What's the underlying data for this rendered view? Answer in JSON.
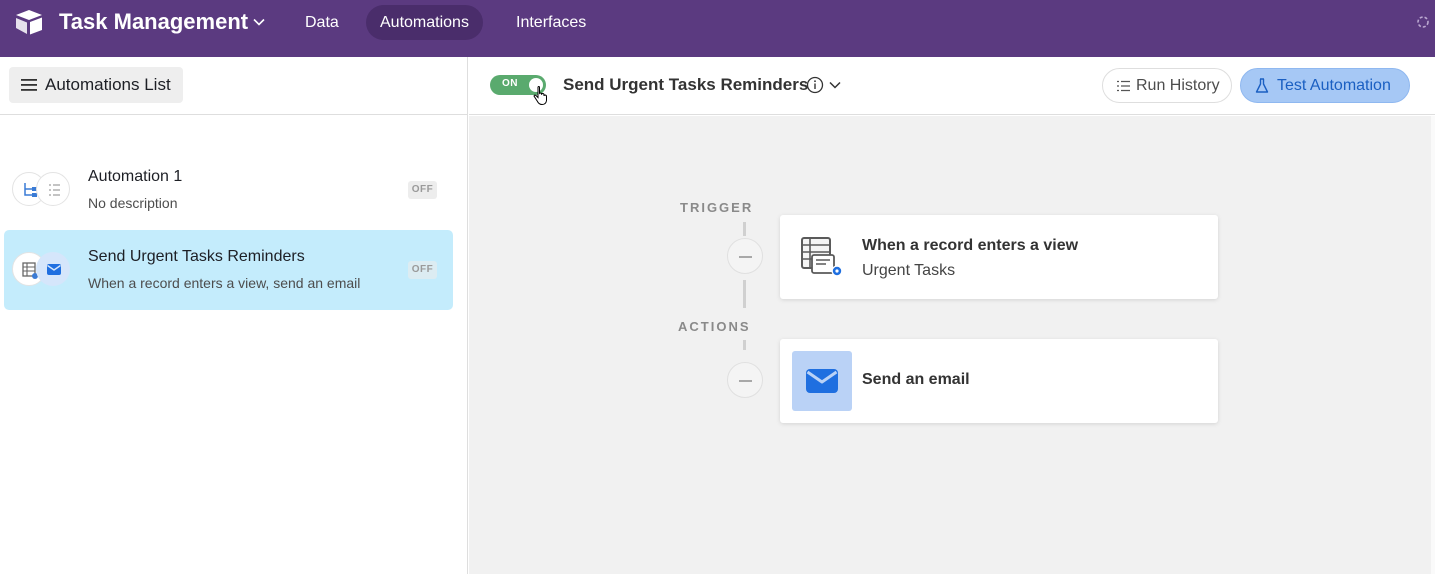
{
  "topbar": {
    "app_title": "Task Management",
    "nav": [
      {
        "label": "Data",
        "active": false
      },
      {
        "label": "Automations",
        "active": true
      },
      {
        "label": "Interfaces",
        "active": false
      }
    ]
  },
  "left_panel": {
    "list_button_label": "Automations List",
    "automations": [
      {
        "title": "Automation 1",
        "description": "No description",
        "status": "OFF",
        "selected": false
      },
      {
        "title": "Send Urgent Tasks Reminders",
        "description": "When a record enters a view, send an email",
        "status": "OFF",
        "selected": true
      }
    ]
  },
  "header": {
    "toggle_label": "ON",
    "toggle_on": true,
    "workflow_title": "Send Urgent Tasks Reminders",
    "run_history_label": "Run History",
    "test_automation_label": "Test Automation"
  },
  "canvas": {
    "trigger_label": "TRIGGER",
    "actions_label": "ACTIONS",
    "trigger": {
      "title": "When a record enters a view",
      "subtitle": "Urgent Tasks",
      "icon": "table-view-icon"
    },
    "action": {
      "title": "Send an email",
      "icon": "envelope-icon"
    }
  },
  "colors": {
    "topbar": "#5b3a80",
    "active_nav": "#4a2d6b",
    "selected_item": "#c4ecfc",
    "toggle_on": "#5aaa6e",
    "test_button": "#a6c8f5",
    "email_accent": "#1f6fe0"
  }
}
